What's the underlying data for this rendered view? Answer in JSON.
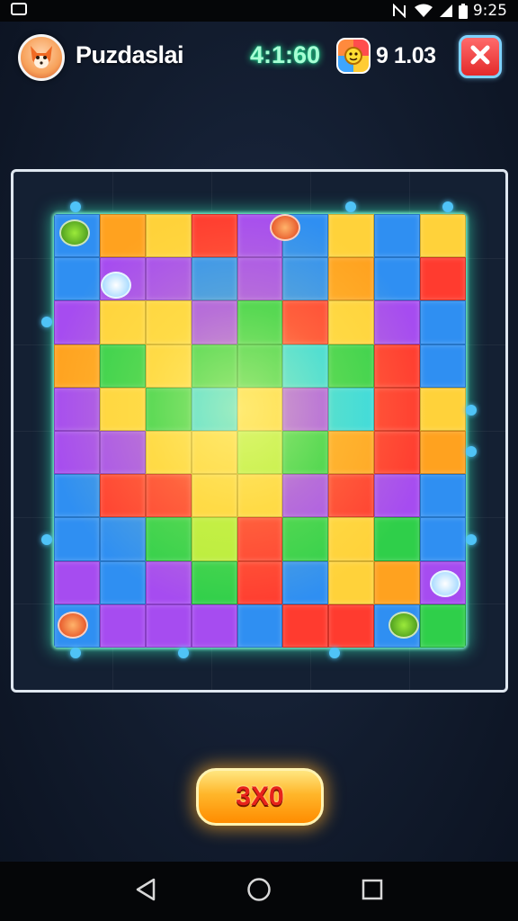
{
  "status_bar": {
    "time": "9:25",
    "icons": [
      "notification-icon",
      "nfc-icon",
      "wifi-icon",
      "signal-icon",
      "battery-icon"
    ]
  },
  "header": {
    "title": "Puzdaslai",
    "timer": "4:1:60",
    "coins": "9 1.03",
    "avatar_icon": "fox-avatar-icon",
    "coin_icon": "coin-badge-icon",
    "close_icon": "close-icon"
  },
  "board": {
    "accent_glow": "#3cffc8",
    "colors": {
      "Y": "#ffd23a",
      "O": "#ffa21f",
      "R": "#ff3b2f",
      "P": "#a64cf0",
      "B": "#2f8ff2",
      "G": "#2fcf4a",
      "C": "#29d7e6",
      "L": "#b7ec3a"
    },
    "rows": [
      "BOYRPBYBY",
      "BPPBPBOBR",
      "PYYPGRYPB",
      "OGYGGCGRB",
      "PYGCYPCRY",
      "PPYYLGORO",
      "BRRYYPRPB",
      "BBGLRGYGB",
      "PBPGRBYOP",
      "BPPPBRRBG"
    ]
  },
  "action_button": {
    "label": "3X0"
  },
  "nav": {
    "back_icon": "back-triangle-icon",
    "home_icon": "home-circle-icon",
    "recents_icon": "recents-square-icon"
  }
}
